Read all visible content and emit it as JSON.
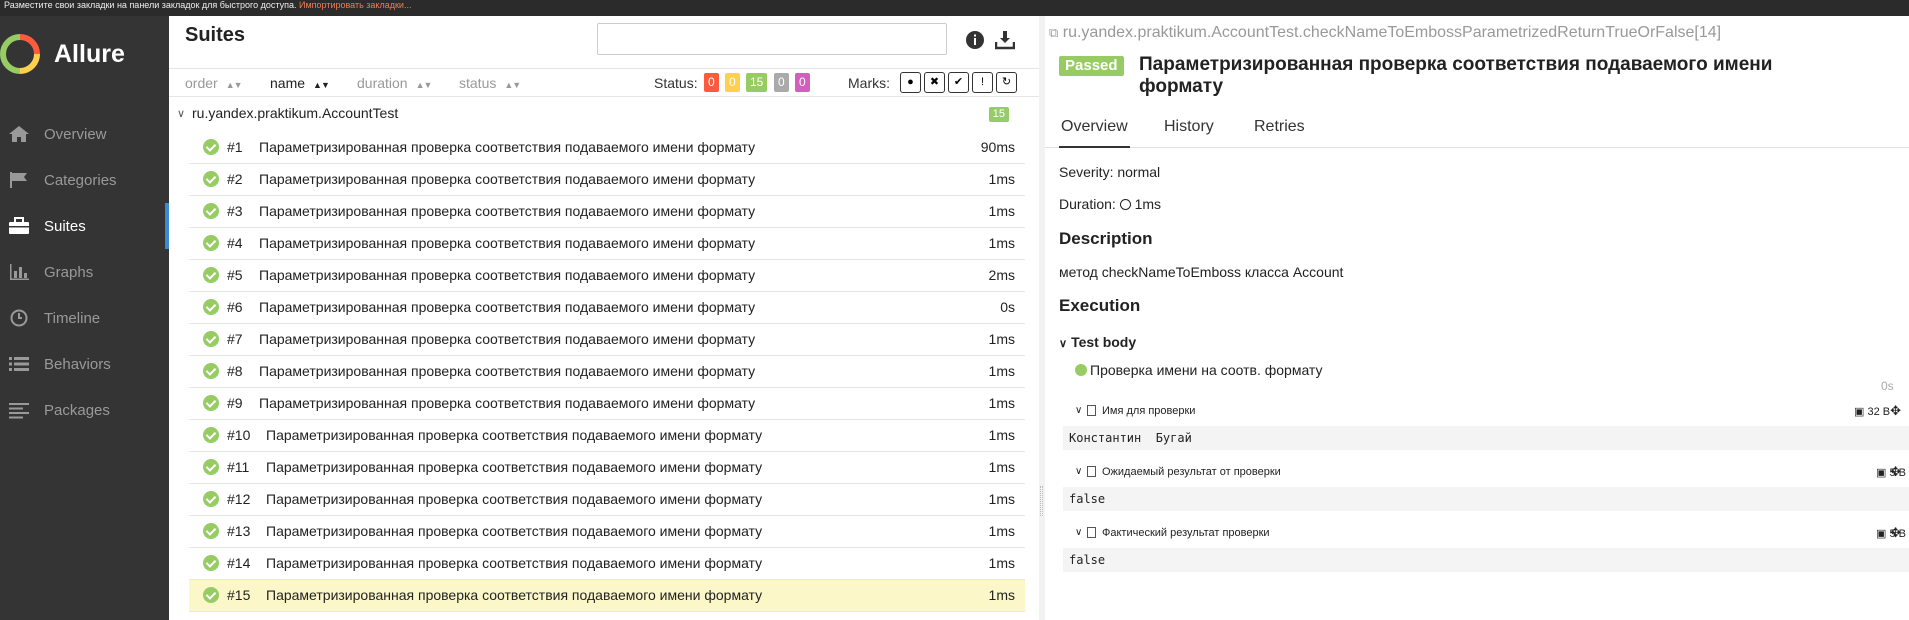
{
  "topbar": {
    "text": "Разместите свои закладки на панели закладок для быстрого доступа.",
    "link": "Импортировать закладки..."
  },
  "app": {
    "name": "Allure"
  },
  "sidebar": {
    "items": [
      {
        "label": "Overview",
        "icon": "home-icon"
      },
      {
        "label": "Categories",
        "icon": "flag-icon"
      },
      {
        "label": "Suites",
        "icon": "briefcase-icon"
      },
      {
        "label": "Graphs",
        "icon": "bar-chart-icon"
      },
      {
        "label": "Timeline",
        "icon": "clock-icon"
      },
      {
        "label": "Behaviors",
        "icon": "list-icon"
      },
      {
        "label": "Packages",
        "icon": "align-left-icon"
      }
    ],
    "active": "Suites"
  },
  "suites": {
    "title": "Suites",
    "search_value": "",
    "columns": {
      "order": "order",
      "name": "name",
      "duration": "duration",
      "status": "status"
    },
    "status_label": "Status:",
    "status_counts": [
      {
        "value": "0",
        "color": "#fd5a3e"
      },
      {
        "value": "0",
        "color": "#ffd050"
      },
      {
        "value": "15",
        "color": "#97cc64"
      },
      {
        "value": "0",
        "color": "#aaaaaa"
      },
      {
        "value": "0",
        "color": "#d35ebe"
      }
    ],
    "marks_label": "Marks:",
    "group": {
      "name": "ru.yandex.praktikum.AccountTest",
      "count": "15"
    },
    "rows": [
      {
        "num": "#1",
        "title": "Параметризированная проверка соответствия подаваемого имени формату",
        "duration": "90ms"
      },
      {
        "num": "#2",
        "title": "Параметризированная проверка соответствия подаваемого имени формату",
        "duration": "1ms"
      },
      {
        "num": "#3",
        "title": "Параметризированная проверка соответствия подаваемого имени формату",
        "duration": "1ms"
      },
      {
        "num": "#4",
        "title": "Параметризированная проверка соответствия подаваемого имени формату",
        "duration": "1ms"
      },
      {
        "num": "#5",
        "title": "Параметризированная проверка соответствия подаваемого имени формату",
        "duration": "2ms"
      },
      {
        "num": "#6",
        "title": "Параметризированная проверка соответствия подаваемого имени формату",
        "duration": "0s"
      },
      {
        "num": "#7",
        "title": "Параметризированная проверка соответствия подаваемого имени формату",
        "duration": "1ms"
      },
      {
        "num": "#8",
        "title": "Параметризированная проверка соответствия подаваемого имени формату",
        "duration": "1ms"
      },
      {
        "num": "#9",
        "title": "Параметризированная проверка соответствия подаваемого имени формату",
        "duration": "1ms"
      },
      {
        "num": "#10",
        "title": "Параметризированная проверка соответствия подаваемого имени формату",
        "duration": "1ms"
      },
      {
        "num": "#11",
        "title": "Параметризированная проверка соответствия подаваемого имени формату",
        "duration": "1ms"
      },
      {
        "num": "#12",
        "title": "Параметризированная проверка соответствия подаваемого имени формату",
        "duration": "1ms"
      },
      {
        "num": "#13",
        "title": "Параметризированная проверка соответствия подаваемого имени формату",
        "duration": "1ms"
      },
      {
        "num": "#14",
        "title": "Параметризированная проверка соответствия подаваемого имени формату",
        "duration": "1ms"
      },
      {
        "num": "#15",
        "title": "Параметризированная проверка соответствия подаваемого имени формату",
        "duration": "1ms"
      }
    ],
    "selected_row": "#15"
  },
  "detail": {
    "breadcrumb": "ru.yandex.praktikum.AccountTest.checkNameToEmbossParametrizedReturnTrueOrFalse[14]",
    "status": "Passed",
    "title": "Параметризированная проверка соответствия подаваемого имени формату",
    "tabs": [
      "Overview",
      "History",
      "Retries"
    ],
    "severity": "Severity: normal",
    "duration_label": "Duration:",
    "duration_value": "1ms",
    "description_heading": "Description",
    "description": "метод checkNameToEmboss класса Account",
    "execution_heading": "Execution",
    "stage": "Test body",
    "step": "Проверка имени на соотв. формату",
    "step_time": "0s",
    "attachments": [
      {
        "label": "Имя для проверки",
        "size": "32 B",
        "content": "Константин  Бугай"
      },
      {
        "label": "Ожидаемый результат от проверки",
        "size": "5 B",
        "content": "false"
      },
      {
        "label": "Фактический результат проверки",
        "size": "5 B",
        "content": "false"
      }
    ]
  }
}
